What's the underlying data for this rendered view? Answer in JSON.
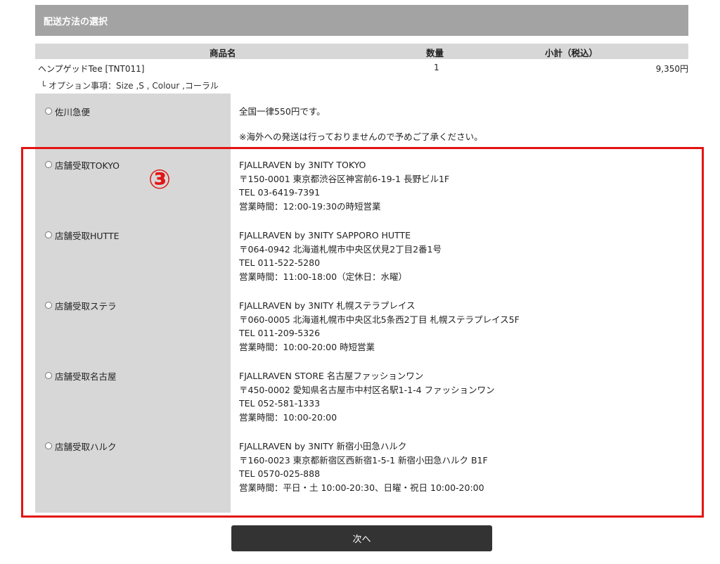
{
  "section_title": "配送方法の選択",
  "table": {
    "headers": {
      "product": "商品名",
      "quantity": "数量",
      "subtotal": "小計（税込）"
    },
    "product": {
      "name": "ヘンプゲッドTee [TNT011]",
      "quantity": "1",
      "subtotal": "9,350円"
    },
    "option": "└ オプション事項：Size ,S , Colour ,コーラル"
  },
  "shipping": [
    {
      "label": "佐川急便",
      "lines": [
        "全国一律550円です。",
        "",
        "※海外への発送は行っておりませんので予めご了承ください。"
      ]
    },
    {
      "label": "店舗受取TOKYO",
      "lines": [
        "FJALLRAVEN by 3NITY TOKYO",
        "〒150-0001 東京都渋谷区神宮前6-19-1 長野ビル1F",
        "TEL 03-6419-7391",
        "営業時間：12:00-19:30の時短営業"
      ]
    },
    {
      "label": "店舗受取HUTTE",
      "lines": [
        "FJALLRAVEN by 3NITY SAPPORO HUTTE",
        "〒064-0942 北海道札幌市中央区伏見2丁目2番1号",
        "TEL 011-522-5280",
        "営業時間：11:00-18:00（定休日：水曜）"
      ]
    },
    {
      "label": "店舗受取ステラ",
      "lines": [
        "FJALLRAVEN by 3NITY 札幌ステラプレイス",
        "〒060-0005 北海道札幌市中央区北5条西2丁目 札幌ステラプレイス5F",
        "TEL 011-209-5326",
        "営業時間：10:00-20:00 時短営業"
      ]
    },
    {
      "label": "店舗受取名古屋",
      "lines": [
        "FJALLRAVEN STORE 名古屋ファッションワン",
        "〒450-0002 愛知県名古屋市中村区名駅1-1-4 ファッションワン",
        "TEL 052-581-1333",
        "営業時間：10:00-20:00"
      ]
    },
    {
      "label": "店舗受取ハルク",
      "lines": [
        "FJALLRAVEN by 3NITY 新宿小田急ハルク",
        "〒160-0023 東京都新宿区西新宿1-5-1 新宿小田急ハルク B1F",
        "TEL 0570-025-888",
        "営業時間：平日・土 10:00-20:30、日曜・祝日 10:00-20:00"
      ]
    }
  ],
  "annotation": "③",
  "next_button": "次へ",
  "colors": {
    "annotation": "#e31414",
    "header_bg": "#a3a3a3",
    "label_bg": "#d7d7d7",
    "button_bg": "#333333"
  }
}
